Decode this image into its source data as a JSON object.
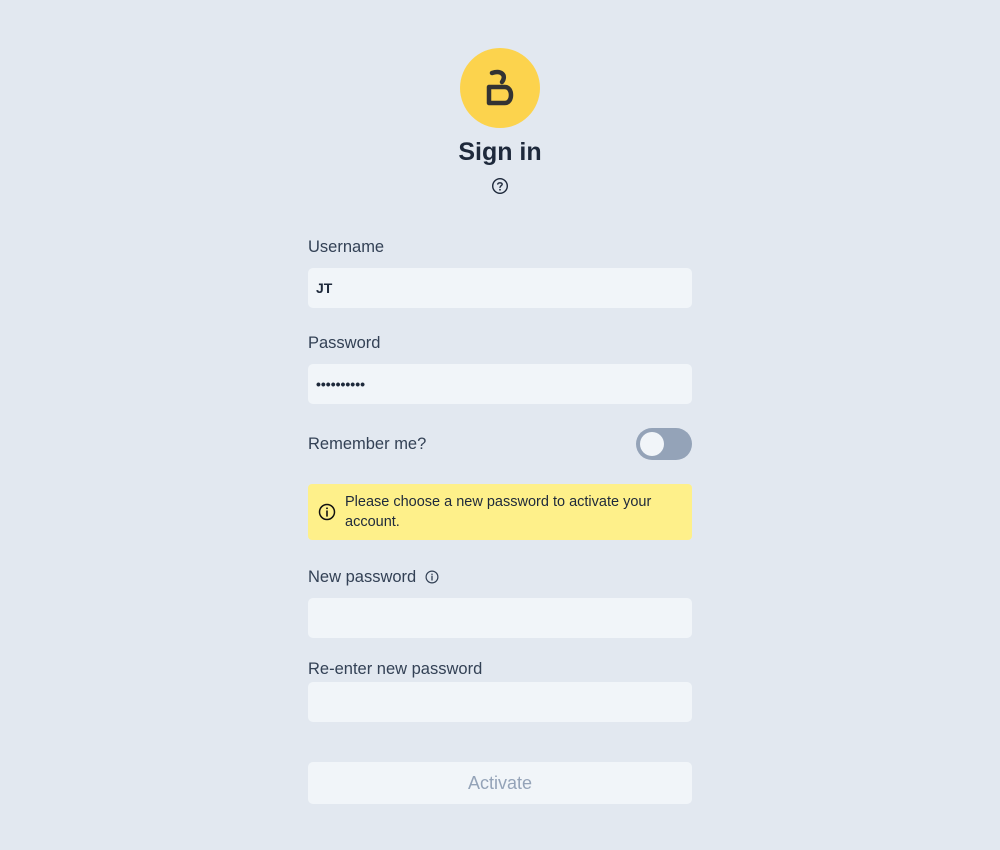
{
  "header": {
    "logo_icon": "letter-b-logo",
    "title": "Sign in",
    "help_icon": "question-circle-icon"
  },
  "colors": {
    "background": "#e2e8f0",
    "logo_bg": "#fcd34d",
    "alert_bg": "#fef08a",
    "input_bg": "#f1f5f9",
    "toggle_off": "#94a3b8"
  },
  "form": {
    "username": {
      "label": "Username",
      "value": "JT"
    },
    "password": {
      "label": "Password",
      "value": "••••••••••"
    },
    "remember": {
      "label": "Remember me?",
      "checked": false
    },
    "alert": {
      "icon": "info-circle-icon",
      "text": "Please choose a new password to activate your account."
    },
    "new_password": {
      "label": "New password",
      "value": "",
      "info_icon": "info-circle-icon"
    },
    "reenter_password": {
      "label": "Re-enter new password",
      "value": ""
    },
    "submit_label": "Activate"
  }
}
